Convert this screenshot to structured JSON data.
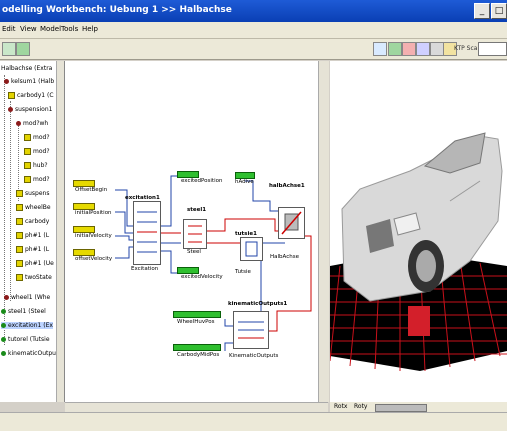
{
  "window": {
    "title": "odelling Workbench: Uebung 1 >> Halbachse"
  },
  "menu": [
    "Edit",
    "View",
    "Model",
    "Tools",
    "Help"
  ],
  "toolbar": {
    "scale_label": "KTP Scale"
  },
  "tree": {
    "items": [
      {
        "label": "Halbachse (Extra",
        "dot": "none"
      },
      {
        "label": "kelsum1 (Halb",
        "dot": "red"
      },
      {
        "label": "carbody1 (C",
        "dot": "yel"
      },
      {
        "label": "suspension1",
        "dot": "red"
      },
      {
        "label": "mod?wh",
        "dot": "red"
      },
      {
        "label": "mod?",
        "dot": "yel"
      },
      {
        "label": "mod?",
        "dot": "yel"
      },
      {
        "label": "hub?",
        "dot": "yel"
      },
      {
        "label": "mod?",
        "dot": "yel"
      },
      {
        "label": "suspens",
        "dot": "yel"
      },
      {
        "label": "wheelBe",
        "dot": "yel"
      },
      {
        "label": "carbody",
        "dot": "yel"
      },
      {
        "label": "ph#1 (L",
        "dot": "yel"
      },
      {
        "label": "ph#1 (L",
        "dot": "yel"
      },
      {
        "label": "ph#1 (Ue",
        "dot": "yel"
      },
      {
        "label": "twoState",
        "dot": "yel"
      },
      {
        "label": "wheel1 (Whe",
        "dot": "red"
      },
      {
        "label": "steel1 (Steel",
        "dot": "grn"
      },
      {
        "label": "excitation1 (Ex",
        "dot": "grn"
      },
      {
        "label": "tutorel (Tutsie",
        "dot": "grn"
      },
      {
        "label": "kinematicOutputs",
        "dot": "grn"
      }
    ]
  },
  "diagram": {
    "inputs": [
      "OffsetBegin",
      "initialPosition",
      "initialVelocity",
      "offsetVelocity"
    ],
    "excitation_block": {
      "title": "excitation1",
      "label": "Excitation"
    },
    "steel_block": {
      "title": "steel1",
      "label": "Steel"
    },
    "tutsie_block": {
      "title": "tutsie1",
      "label": "Tutsie"
    },
    "halb_block": {
      "title": "halbAchse1",
      "label": "HalbAchse"
    },
    "kin_block": {
      "title": "kinematicOutputs1",
      "label": "KinematicOutputs"
    },
    "signals": [
      "excitedPosition",
      "excitedVelocity",
      "hAdive",
      "WheelHuvPos",
      "CarbodyMidPos"
    ]
  },
  "view3d": {
    "controls": [
      "Rotx",
      "Roty"
    ],
    "colors": {
      "grid": "#c8101a",
      "pedestal": "#d31f2a",
      "body": "#d9d9d9",
      "bg": "#ffffff"
    }
  },
  "colors": {
    "title_blue": "#0a3fb4",
    "port_yellow": "#e6da00",
    "port_green": "#2fbf2f",
    "link_red": "#cc0000",
    "link_blue": "#2244aa"
  }
}
